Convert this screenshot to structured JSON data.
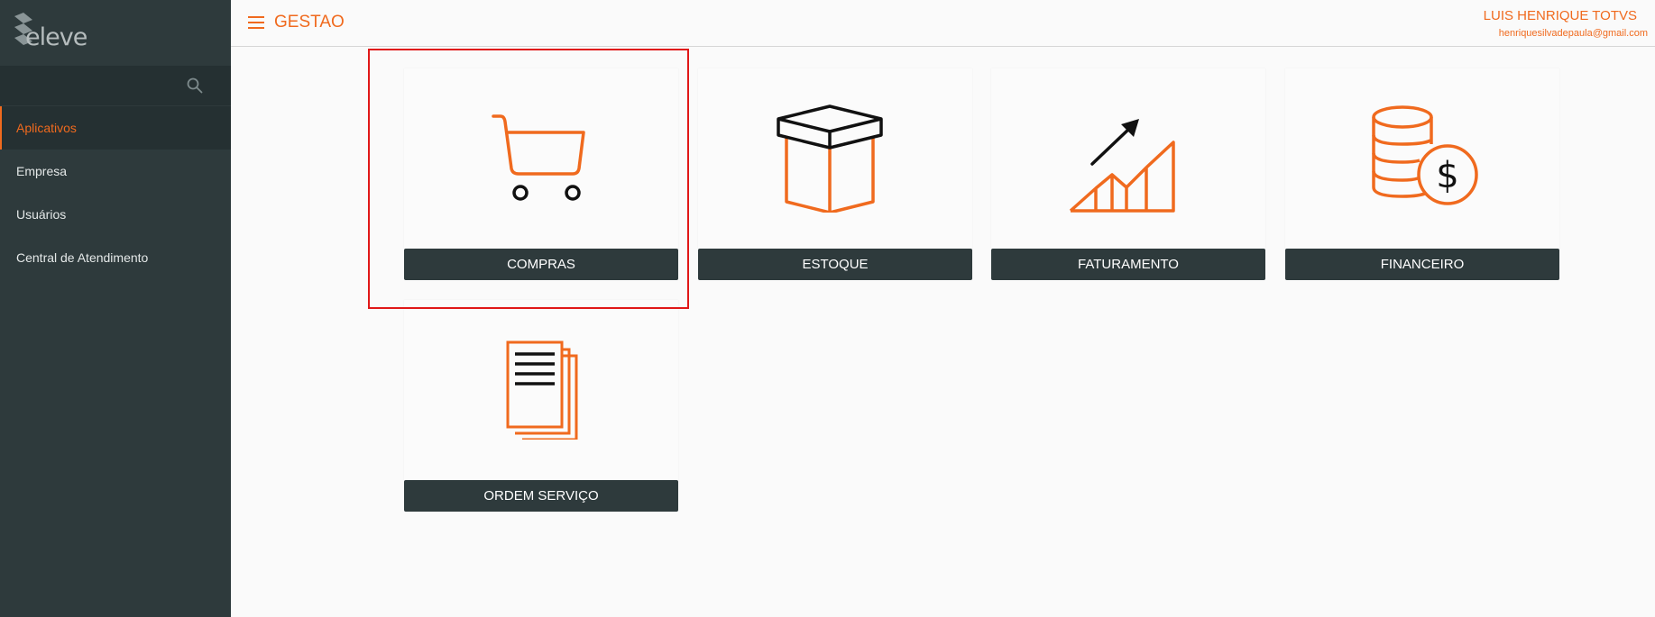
{
  "app": {
    "logo_text": "eleve",
    "header_title": "GESTAO"
  },
  "user": {
    "name": "LUIS HENRIQUE TOTVS",
    "email": "henriquesilvadepaula@gmail.com"
  },
  "sidebar": {
    "items": [
      {
        "label": "Aplicativos",
        "active": true
      },
      {
        "label": "Empresa",
        "active": false
      },
      {
        "label": "Usuários",
        "active": false
      },
      {
        "label": "Central de Atendimento",
        "active": false
      }
    ]
  },
  "cards": [
    {
      "label": "COMPRAS",
      "icon": "shopping-cart-icon"
    },
    {
      "label": "ESTOQUE",
      "icon": "box-icon"
    },
    {
      "label": "FATURAMENTO",
      "icon": "growth-chart-icon"
    },
    {
      "label": "FINANCEIRO",
      "icon": "coins-dollar-icon"
    },
    {
      "label": "ORDEM SERVIÇO",
      "icon": "documents-icon"
    }
  ],
  "colors": {
    "accent": "#f06a1e",
    "sidebar_bg": "#2e3a3c",
    "highlight": "#e01818"
  }
}
